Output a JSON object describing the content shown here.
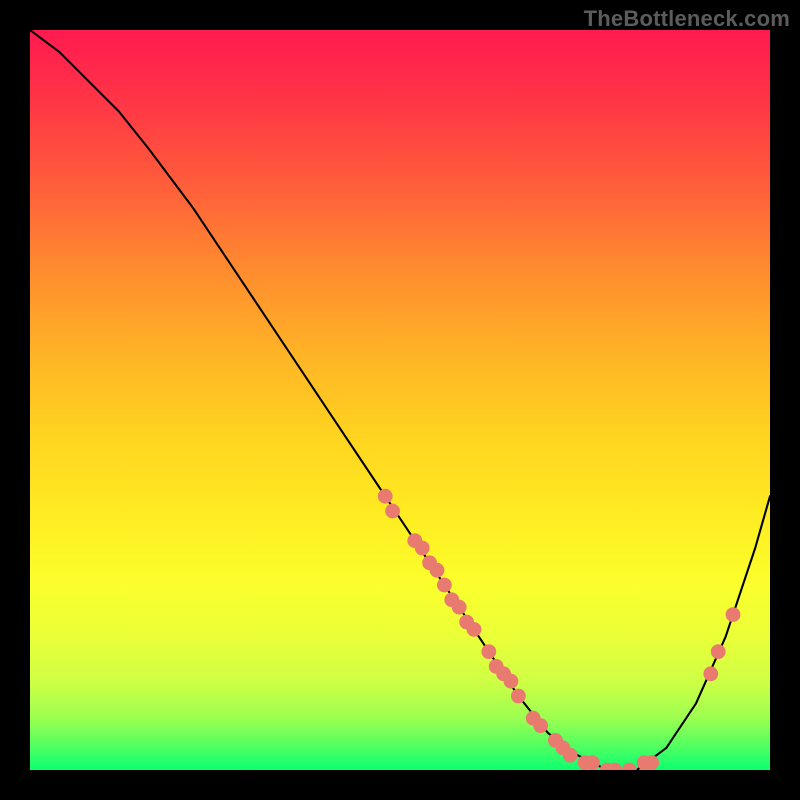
{
  "watermark": "TheBottleneck.com",
  "chart_data": {
    "type": "line",
    "title": "",
    "xlabel": "",
    "ylabel": "",
    "xlim": [
      0,
      100
    ],
    "ylim": [
      0,
      100
    ],
    "grid": false,
    "legend": false,
    "series": [
      {
        "name": "curve",
        "x": [
          0,
          4,
          8,
          12,
          16,
          22,
          28,
          34,
          40,
          46,
          52,
          58,
          62,
          66,
          70,
          74,
          78,
          82,
          86,
          90,
          94,
          98,
          100
        ],
        "y": [
          100,
          97,
          93,
          89,
          84,
          76,
          67,
          58,
          49,
          40,
          31,
          22,
          16,
          10,
          5,
          2,
          0,
          0,
          3,
          9,
          18,
          30,
          37
        ]
      }
    ],
    "scatter": {
      "name": "points",
      "color": "#e97a6f",
      "radius": 1.0,
      "points": [
        {
          "x": 48,
          "y": 37
        },
        {
          "x": 49,
          "y": 35
        },
        {
          "x": 52,
          "y": 31
        },
        {
          "x": 53,
          "y": 30
        },
        {
          "x": 54,
          "y": 28
        },
        {
          "x": 55,
          "y": 27
        },
        {
          "x": 56,
          "y": 25
        },
        {
          "x": 57,
          "y": 23
        },
        {
          "x": 58,
          "y": 22
        },
        {
          "x": 59,
          "y": 20
        },
        {
          "x": 60,
          "y": 19
        },
        {
          "x": 62,
          "y": 16
        },
        {
          "x": 63,
          "y": 14
        },
        {
          "x": 64,
          "y": 13
        },
        {
          "x": 65,
          "y": 12
        },
        {
          "x": 66,
          "y": 10
        },
        {
          "x": 68,
          "y": 7
        },
        {
          "x": 69,
          "y": 6
        },
        {
          "x": 71,
          "y": 4
        },
        {
          "x": 72,
          "y": 3
        },
        {
          "x": 73,
          "y": 2
        },
        {
          "x": 75,
          "y": 1
        },
        {
          "x": 76,
          "y": 1
        },
        {
          "x": 78,
          "y": 0
        },
        {
          "x": 79,
          "y": 0
        },
        {
          "x": 81,
          "y": 0
        },
        {
          "x": 83,
          "y": 1
        },
        {
          "x": 84,
          "y": 1
        },
        {
          "x": 92,
          "y": 13
        },
        {
          "x": 93,
          "y": 16
        },
        {
          "x": 95,
          "y": 21
        }
      ]
    }
  }
}
